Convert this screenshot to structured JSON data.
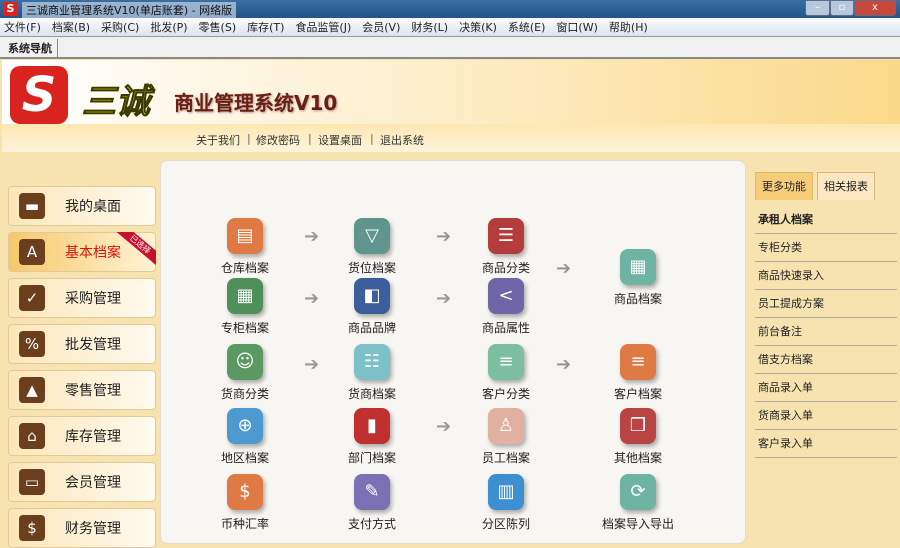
{
  "window": {
    "title": "三诚商业管理系统V10(单店账套) - 网络版",
    "minimize": "–",
    "restore": "▫",
    "close": "x"
  },
  "menu": [
    "文件(F)",
    "档案(B)",
    "采购(C)",
    "批发(P)",
    "零售(S)",
    "库存(T)",
    "食品监管(J)",
    "会员(V)",
    "财务(L)",
    "决策(K)",
    "系统(E)",
    "窗口(W)",
    "帮助(H)"
  ],
  "tab": "系统导航",
  "header": {
    "logo": "S",
    "brand": "三诚",
    "title": "商业管理系统V10",
    "links": [
      "关于我们",
      "修改密码",
      "设置桌面",
      "退出系统"
    ],
    "sep": "|"
  },
  "nav": [
    {
      "label": "我的桌面",
      "icon": "▬"
    },
    {
      "label": "基本档案",
      "icon": "A",
      "badge": "已选择"
    },
    {
      "label": "采购管理",
      "icon": "✓"
    },
    {
      "label": "批发管理",
      "icon": "%"
    },
    {
      "label": "零售管理",
      "icon": "▲"
    },
    {
      "label": "库存管理",
      "icon": "⌂"
    },
    {
      "label": "会员管理",
      "icon": "▭"
    },
    {
      "label": "财务管理",
      "icon": "$"
    }
  ],
  "tiles": [
    {
      "label": "仓库档案",
      "color": "#e07a45",
      "icon": "▤"
    },
    {
      "label": "货位档案",
      "color": "#5f958c",
      "icon": "▽"
    },
    {
      "label": "商品分类",
      "color": "#b43c3c",
      "icon": "☰"
    },
    {
      "label": "专柜档案",
      "color": "#4f8f5a",
      "icon": "▦"
    },
    {
      "label": "商品品牌",
      "color": "#3c5f9c",
      "icon": "◧"
    },
    {
      "label": "商品属性",
      "color": "#6e66a8",
      "icon": "<"
    },
    {
      "label": "商品档案",
      "color": "#6fb3a2",
      "icon": "▦"
    },
    {
      "label": "货商分类",
      "color": "#5a9a62",
      "icon": "☺"
    },
    {
      "label": "货商档案",
      "color": "#7cc0c8",
      "icon": "☷"
    },
    {
      "label": "客户分类",
      "color": "#7bbfa0",
      "icon": "≡"
    },
    {
      "label": "客户档案",
      "color": "#e07a45",
      "icon": "≡"
    },
    {
      "label": "地区档案",
      "color": "#4e9ad0",
      "icon": "⊕"
    },
    {
      "label": "部门档案",
      "color": "#c0302e",
      "icon": "▮"
    },
    {
      "label": "员工档案",
      "color": "#e0b0a0",
      "icon": "♙"
    },
    {
      "label": "其他档案",
      "color": "#b84444",
      "icon": "❒"
    },
    {
      "label": "币种汇率",
      "color": "#e07a45",
      "icon": "$"
    },
    {
      "label": "支付方式",
      "color": "#7a70b4",
      "icon": "✎"
    },
    {
      "label": "分区陈列",
      "color": "#3e8fd0",
      "icon": "▥"
    },
    {
      "label": "档案导入导出",
      "color": "#6fb3a2",
      "icon": "⟳"
    }
  ],
  "arrow": "➔",
  "right": {
    "tabs": [
      "更多功能",
      "相关报表"
    ],
    "items": [
      "承租人档案",
      "专柜分类",
      "商品快速录入",
      "员工提成方案",
      "前台备注",
      "借支方档案",
      "商品录入单",
      "货商录入单",
      "客户录入单"
    ]
  }
}
